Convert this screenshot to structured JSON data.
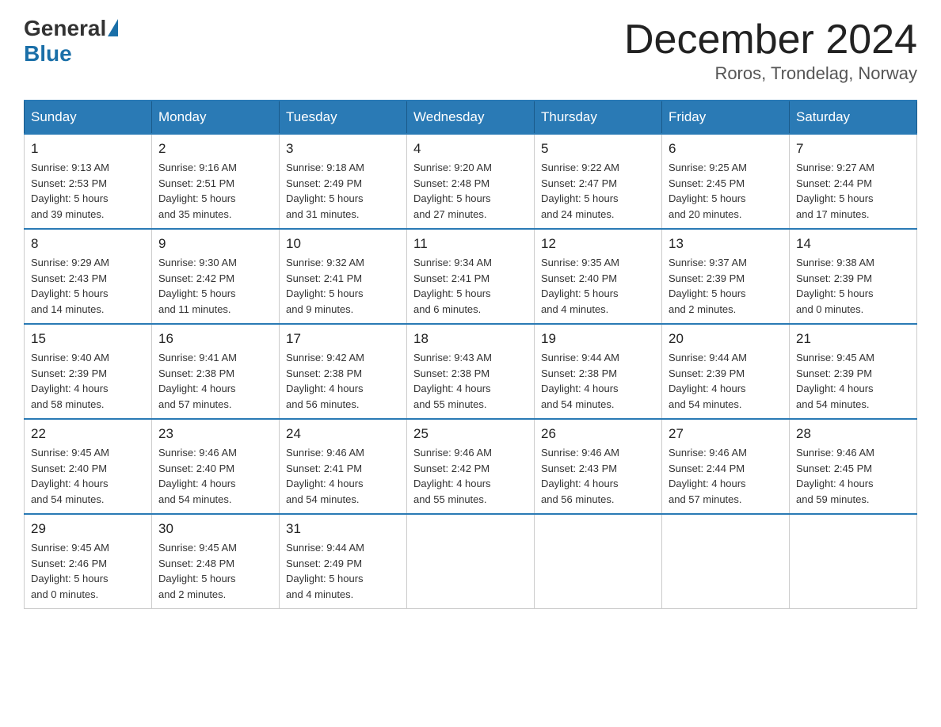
{
  "logo": {
    "general": "General",
    "blue": "Blue"
  },
  "header": {
    "month": "December 2024",
    "location": "Roros, Trondelag, Norway"
  },
  "days_of_week": [
    "Sunday",
    "Monday",
    "Tuesday",
    "Wednesday",
    "Thursday",
    "Friday",
    "Saturday"
  ],
  "weeks": [
    [
      {
        "day": "1",
        "sunrise": "9:13 AM",
        "sunset": "2:53 PM",
        "daylight": "5 hours and 39 minutes."
      },
      {
        "day": "2",
        "sunrise": "9:16 AM",
        "sunset": "2:51 PM",
        "daylight": "5 hours and 35 minutes."
      },
      {
        "day": "3",
        "sunrise": "9:18 AM",
        "sunset": "2:49 PM",
        "daylight": "5 hours and 31 minutes."
      },
      {
        "day": "4",
        "sunrise": "9:20 AM",
        "sunset": "2:48 PM",
        "daylight": "5 hours and 27 minutes."
      },
      {
        "day": "5",
        "sunrise": "9:22 AM",
        "sunset": "2:47 PM",
        "daylight": "5 hours and 24 minutes."
      },
      {
        "day": "6",
        "sunrise": "9:25 AM",
        "sunset": "2:45 PM",
        "daylight": "5 hours and 20 minutes."
      },
      {
        "day": "7",
        "sunrise": "9:27 AM",
        "sunset": "2:44 PM",
        "daylight": "5 hours and 17 minutes."
      }
    ],
    [
      {
        "day": "8",
        "sunrise": "9:29 AM",
        "sunset": "2:43 PM",
        "daylight": "5 hours and 14 minutes."
      },
      {
        "day": "9",
        "sunrise": "9:30 AM",
        "sunset": "2:42 PM",
        "daylight": "5 hours and 11 minutes."
      },
      {
        "day": "10",
        "sunrise": "9:32 AM",
        "sunset": "2:41 PM",
        "daylight": "5 hours and 9 minutes."
      },
      {
        "day": "11",
        "sunrise": "9:34 AM",
        "sunset": "2:41 PM",
        "daylight": "5 hours and 6 minutes."
      },
      {
        "day": "12",
        "sunrise": "9:35 AM",
        "sunset": "2:40 PM",
        "daylight": "5 hours and 4 minutes."
      },
      {
        "day": "13",
        "sunrise": "9:37 AM",
        "sunset": "2:39 PM",
        "daylight": "5 hours and 2 minutes."
      },
      {
        "day": "14",
        "sunrise": "9:38 AM",
        "sunset": "2:39 PM",
        "daylight": "5 hours and 0 minutes."
      }
    ],
    [
      {
        "day": "15",
        "sunrise": "9:40 AM",
        "sunset": "2:39 PM",
        "daylight": "4 hours and 58 minutes."
      },
      {
        "day": "16",
        "sunrise": "9:41 AM",
        "sunset": "2:38 PM",
        "daylight": "4 hours and 57 minutes."
      },
      {
        "day": "17",
        "sunrise": "9:42 AM",
        "sunset": "2:38 PM",
        "daylight": "4 hours and 56 minutes."
      },
      {
        "day": "18",
        "sunrise": "9:43 AM",
        "sunset": "2:38 PM",
        "daylight": "4 hours and 55 minutes."
      },
      {
        "day": "19",
        "sunrise": "9:44 AM",
        "sunset": "2:38 PM",
        "daylight": "4 hours and 54 minutes."
      },
      {
        "day": "20",
        "sunrise": "9:44 AM",
        "sunset": "2:39 PM",
        "daylight": "4 hours and 54 minutes."
      },
      {
        "day": "21",
        "sunrise": "9:45 AM",
        "sunset": "2:39 PM",
        "daylight": "4 hours and 54 minutes."
      }
    ],
    [
      {
        "day": "22",
        "sunrise": "9:45 AM",
        "sunset": "2:40 PM",
        "daylight": "4 hours and 54 minutes."
      },
      {
        "day": "23",
        "sunrise": "9:46 AM",
        "sunset": "2:40 PM",
        "daylight": "4 hours and 54 minutes."
      },
      {
        "day": "24",
        "sunrise": "9:46 AM",
        "sunset": "2:41 PM",
        "daylight": "4 hours and 54 minutes."
      },
      {
        "day": "25",
        "sunrise": "9:46 AM",
        "sunset": "2:42 PM",
        "daylight": "4 hours and 55 minutes."
      },
      {
        "day": "26",
        "sunrise": "9:46 AM",
        "sunset": "2:43 PM",
        "daylight": "4 hours and 56 minutes."
      },
      {
        "day": "27",
        "sunrise": "9:46 AM",
        "sunset": "2:44 PM",
        "daylight": "4 hours and 57 minutes."
      },
      {
        "day": "28",
        "sunrise": "9:46 AM",
        "sunset": "2:45 PM",
        "daylight": "4 hours and 59 minutes."
      }
    ],
    [
      {
        "day": "29",
        "sunrise": "9:45 AM",
        "sunset": "2:46 PM",
        "daylight": "5 hours and 0 minutes."
      },
      {
        "day": "30",
        "sunrise": "9:45 AM",
        "sunset": "2:48 PM",
        "daylight": "5 hours and 2 minutes."
      },
      {
        "day": "31",
        "sunrise": "9:44 AM",
        "sunset": "2:49 PM",
        "daylight": "5 hours and 4 minutes."
      },
      null,
      null,
      null,
      null
    ]
  ],
  "labels": {
    "sunrise": "Sunrise:",
    "sunset": "Sunset:",
    "daylight": "Daylight:"
  }
}
